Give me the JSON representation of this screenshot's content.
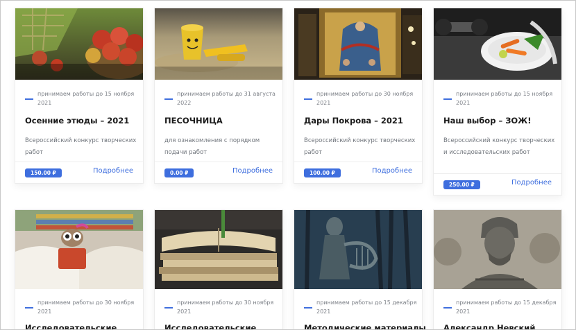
{
  "cards": [
    {
      "date": "принимаем работы до 15 ноября 2021",
      "title": "Осенние этюды – 2021",
      "desc": "Всероссийский конкурс творческих работ",
      "price": "150.00 ₽",
      "more": "Подробнее"
    },
    {
      "date": "принимаем работы до 31 августа 2022",
      "title": "ПЕСОЧНИЦА",
      "desc": "для ознакомления с порядком подачи работ",
      "price": "0.00 ₽",
      "more": "Подробнее"
    },
    {
      "date": "принимаем работы до 30 ноября 2021",
      "title": "Дары Покрова – 2021",
      "desc": "Всероссийский конкурс творческих работ",
      "price": "100.00 ₽",
      "more": "Подробнее"
    },
    {
      "date": "принимаем работы до 15 ноября 2021",
      "title": "Наш выбор – ЗОЖ!",
      "desc": "Всероссийский конкурс творческих и исследовательских работ",
      "price": "250.00 ₽",
      "more": "Подробнее"
    },
    {
      "date": "принимаем работы до 30 ноября 2021",
      "title": "Исследовательские"
    },
    {
      "date": "принимаем работы до 30 ноября 2021",
      "title": "Исследовательские"
    },
    {
      "date": "принимаем работы до 15 декабря 2021",
      "title": "Методические материалы"
    },
    {
      "date": "принимаем работы до 15 декабря 2021",
      "title": "Александр Невский"
    }
  ],
  "icons": {
    "card_1_image": "apples-basket-image",
    "card_2_image": "sand-bucket-toy-image",
    "card_3_image": "icon-painting-image",
    "card_4_image": "vegetables-dumbbell-image",
    "card_5_image": "open-book-figure-image",
    "card_6_image": "book-stack-image",
    "card_7_image": "statue-in-park-image",
    "card_8_image": "nevsky-monument-image"
  },
  "colors": {
    "accent": "#3e6ede",
    "price_bg": "#3e6ede"
  }
}
